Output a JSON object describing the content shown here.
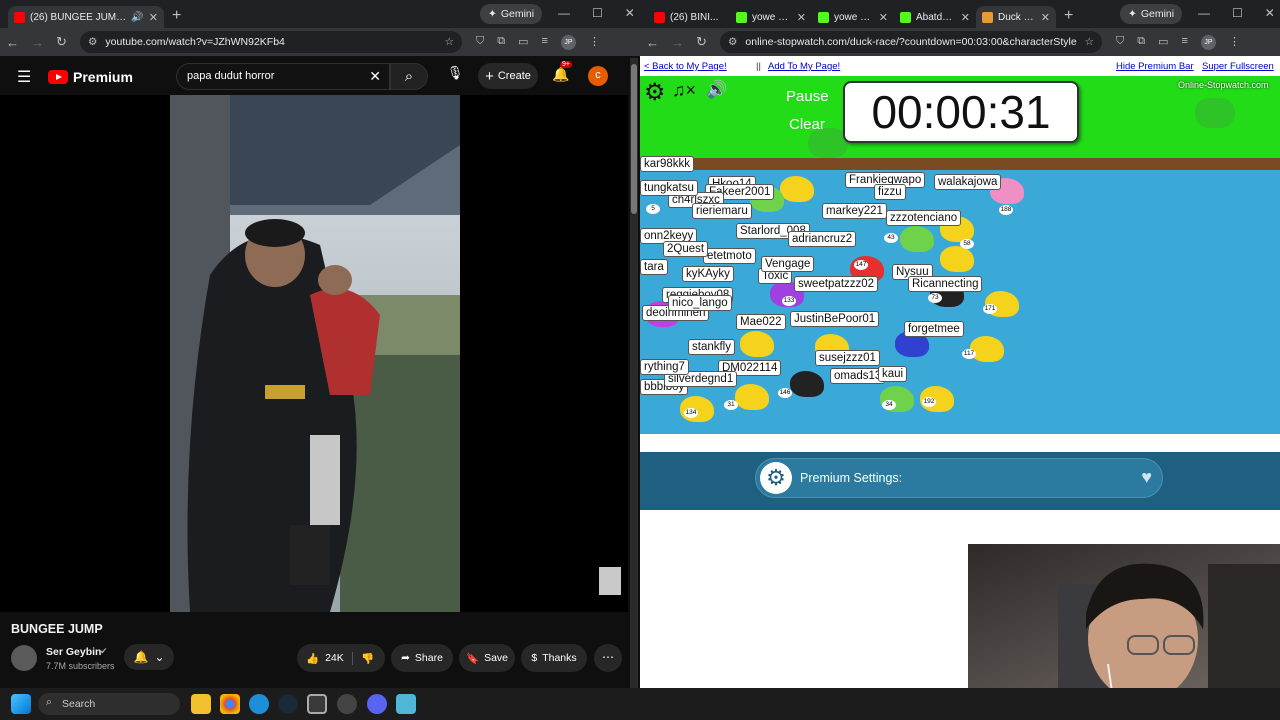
{
  "left_browser": {
    "tabs": [
      {
        "title": "(26) BUNGEE JUMP - YouTube",
        "active": true
      }
    ],
    "gemini_label": "Gemini",
    "url": "youtube.com/watch?v=JZhWN92KFb4",
    "profile_initials": "JP"
  },
  "youtube": {
    "logo_text": "Premium",
    "search_value": "papa dudut horror",
    "create_label": "Create",
    "notif_count": "9+",
    "avatar_letter": "c",
    "video_title": "BUNGEE JUMP",
    "channel_name": "Ser Geybin",
    "subscribers": "7.7M subscribers",
    "likes": "24K",
    "share_label": "Share",
    "save_label": "Save",
    "thanks_label": "Thanks"
  },
  "right_browser": {
    "tabs": [
      {
        "title": "(26) BINI..."
      },
      {
        "title": "yowe Stre..."
      },
      {
        "title": "yowe Stre..."
      },
      {
        "title": "Abatdota..."
      },
      {
        "title": "Duck Race",
        "active": true
      }
    ],
    "gemini_label": "Gemini",
    "url": "online-stopwatch.com/duck-race/?countdown=00:03:00&characterStyle=0&...",
    "profile_initials": "JP"
  },
  "stopwatch": {
    "link_back": "< Back to My Page!",
    "link_sep": "||",
    "link_add": "Add To My Page!",
    "link_hide": "Hide Premium Bar",
    "link_full": "Super Fullscreen",
    "pause_label": "Pause",
    "clear_label": "Clear",
    "time": "00:00:31",
    "brand": "Online-Stopwatch.com",
    "premium_settings": "Premium Settings:",
    "players": [
      "Frankieqwapo",
      "walakajowa",
      "fizzu",
      "Hkoo14",
      "Fakeer2001",
      "ch4rlszxc",
      "rieriemaru",
      "markey221",
      "zzzotenciano",
      "Starlord_008",
      "adriancruz2",
      "onn2keyy",
      "etetmoto",
      "kyKAyky",
      "Toxic",
      "Vengage",
      "sweetpatzzz02",
      "Nysuu",
      "Ricannecting",
      "deoihminen",
      "Mae022",
      "JustinBePoor01",
      "forgetmee",
      "stankfly",
      "susejzzz01",
      "DM022114",
      "omads13",
      "bbbiboy",
      "tungkatsu",
      "kar98kkk",
      "tara",
      "reggieboy08",
      "nico_lango",
      "2Quest",
      "silverdegnd1",
      "rything7",
      "kaui"
    ],
    "duck_numbers": [
      "5",
      "188",
      "58",
      "43",
      "147",
      "73",
      "133",
      "171",
      "117",
      "146",
      "34",
      "192",
      "134",
      "31"
    ]
  },
  "taskbar": {
    "search_label": "Search"
  }
}
